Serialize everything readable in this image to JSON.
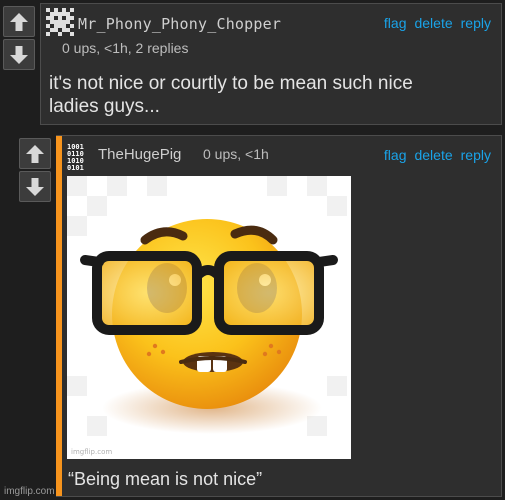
{
  "comment1": {
    "username": "Mr_Phony_Phony_Chopper",
    "meta": "0 ups, <1h, 2 replies",
    "actions": [
      "flag",
      "delete",
      "reply"
    ],
    "text_line1": "it's not nice or courtly to be mean such nice",
    "text_line2": "ladies guys..."
  },
  "comment2": {
    "username": "TheHugePig",
    "meta": "0 ups, <1h",
    "actions": [
      "flag",
      "delete",
      "reply"
    ],
    "image_watermark": "imgflip.com",
    "caption": "“Being mean is not nice”"
  },
  "footer": {
    "watermark": "imgflip.com"
  },
  "colors": {
    "link": "#1aa3e8",
    "accent_bar": "#f7941d",
    "panel": "#2e2e2e",
    "background": "#1e1e1e"
  },
  "icons": {
    "upvote": "arrow-up-icon",
    "downvote": "arrow-down-icon",
    "avatar1": "pixel-avatar-icon",
    "avatar2": "binary-avatar-icon",
    "meme": "nerd-emoji-icon"
  }
}
